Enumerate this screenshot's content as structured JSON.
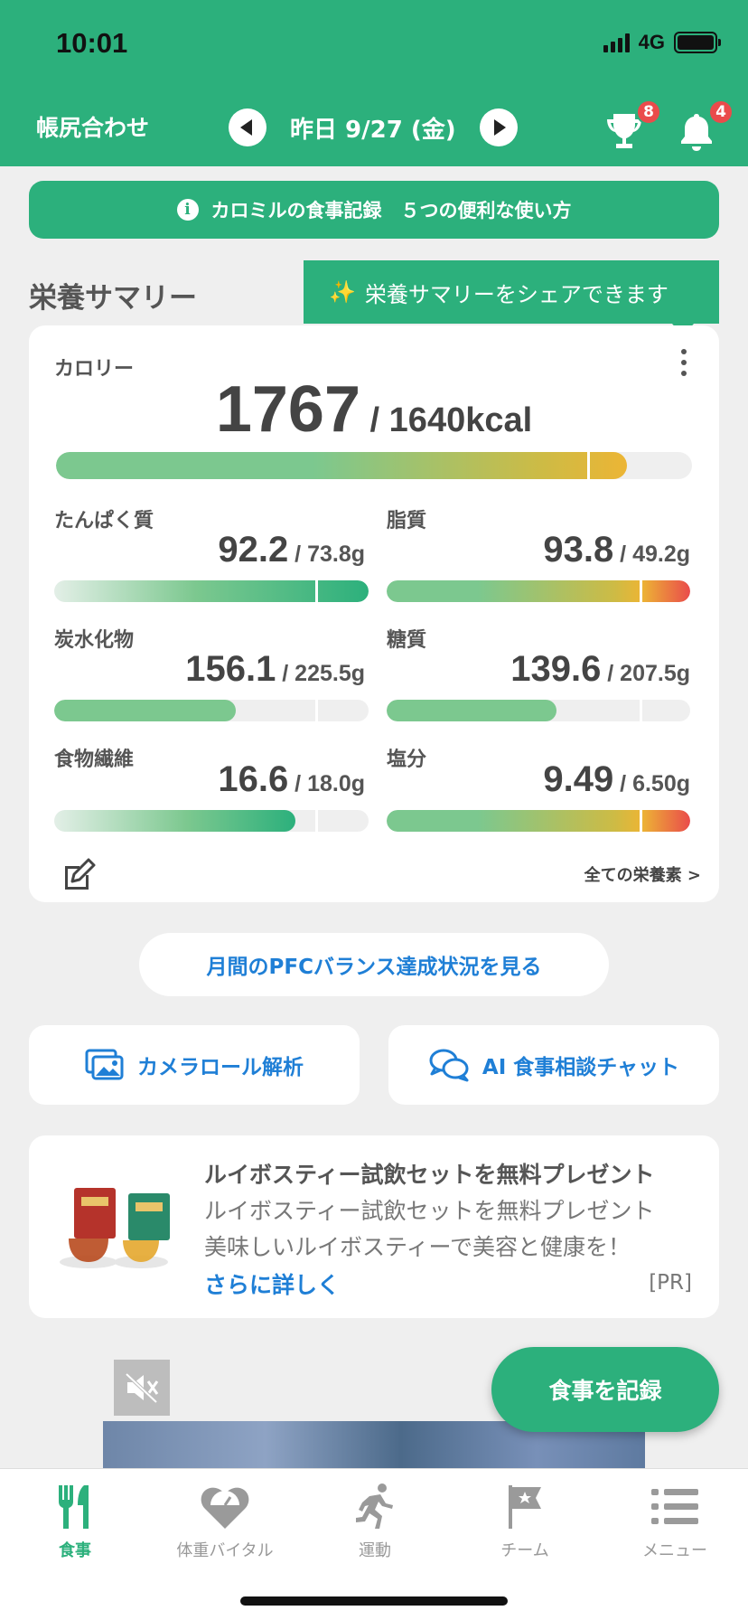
{
  "status": {
    "time": "10:01",
    "network": "4G"
  },
  "header": {
    "left_label": "帳尻合わせ",
    "date": "昨日 9/27 (金)",
    "trophy_badge": "8",
    "bell_badge": "4"
  },
  "banner": {
    "text": "カロミルの食事記録　５つの便利な使い方"
  },
  "summary": {
    "title": "栄養サマリー",
    "share_tip": "栄養サマリーをシェアできます",
    "calorie_label": "カロリー",
    "calorie_value": "1767",
    "calorie_target": " / 1640kcal",
    "calorie_progress": 0.912,
    "nutrients": [
      {
        "label": "たんぱく質",
        "value": "92.2",
        "target": " / 73.8g"
      },
      {
        "label": "脂質",
        "value": "93.8",
        "target": " / 49.2g"
      },
      {
        "label": "炭水化物",
        "value": "156.1",
        "target": " / 225.5g"
      },
      {
        "label": "糖質",
        "value": "139.6",
        "target": " / 207.5g"
      },
      {
        "label": "食物繊維",
        "value": "16.6",
        "target": " / 18.0g"
      },
      {
        "label": "塩分",
        "value": "9.49",
        "target": " / 6.50g"
      }
    ],
    "all_nutrients_link": "全ての栄養素 >"
  },
  "buttons": {
    "pfc": "月間のPFCバランス達成状況を見る",
    "camera_roll": "カメラロール解析",
    "ai_chat": "AI 食事相談チャット",
    "record_meal": "食事を記録"
  },
  "ad": {
    "title": "ルイボスティー試飲セットを無料プレゼント",
    "line1": "ルイボスティー試飲セットを無料プレゼント",
    "line2": "美味しいルイボスティーで美容と健康を！",
    "link": "さらに詳しく",
    "pr": "[PR]"
  },
  "tabs": [
    {
      "label": "食事",
      "icon": "fork-knife-icon"
    },
    {
      "label": "体重バイタル",
      "icon": "heart-scale-icon"
    },
    {
      "label": "運動",
      "icon": "runner-icon"
    },
    {
      "label": "チーム",
      "icon": "flag-icon"
    },
    {
      "label": "メニュー",
      "icon": "list-menu-icon"
    }
  ],
  "colors": {
    "brand_green": "#2cb07c",
    "link_blue": "#1f7fd6",
    "badge_red": "#ea4b4b"
  }
}
